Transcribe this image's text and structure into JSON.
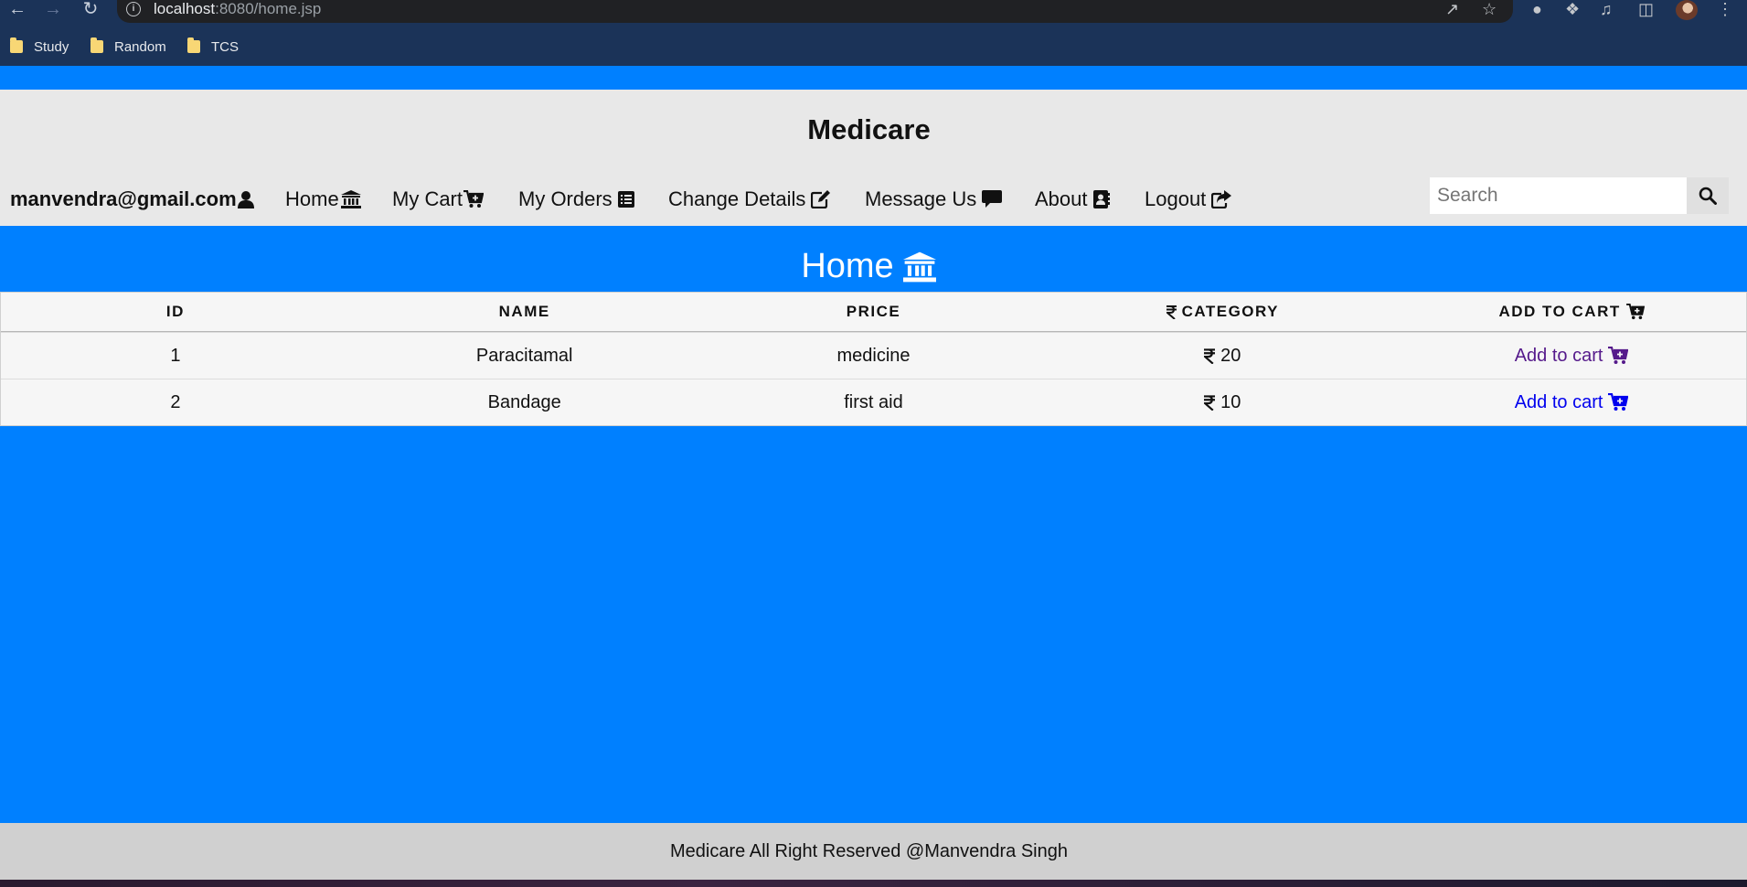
{
  "browser": {
    "url_host": "localhost",
    "url_path": ":8080/home.jsp",
    "bookmarks": [
      "Study",
      "Random",
      "TCS"
    ]
  },
  "header": {
    "brand": "Medicare",
    "user_email": "manvendra@gmail.com",
    "nav": [
      "Home",
      "My Cart",
      "My Orders",
      "Change Details",
      "Message Us",
      "About",
      "Logout"
    ],
    "search_placeholder": "Search"
  },
  "main": {
    "title": "Home",
    "columns": [
      "ID",
      "NAME",
      "PRICE",
      "CATEGORY",
      "ADD TO CART"
    ],
    "rows": [
      {
        "id": "1",
        "name": "Paracitamal",
        "category": "medicine",
        "price": "20",
        "action": "Add to cart"
      },
      {
        "id": "2",
        "name": "Bandage",
        "category": "first aid",
        "price": "10",
        "action": "Add to cart"
      }
    ]
  },
  "footer": {
    "text": "Medicare All Right Reserved @Manvendra Singh"
  },
  "colors": {
    "page_blue": "#0080ff",
    "header_gray": "#e8e8e8",
    "footer_gray": "#d0d0d0",
    "link_blue": "#0000ee",
    "link_visited": "#551a8b"
  },
  "icons": {
    "user": "user-icon",
    "home": "bank-icon",
    "cart": "cart-plus-icon",
    "orders": "list-alt-icon",
    "edit": "edit-icon",
    "message": "comment-icon",
    "about": "address-book-icon",
    "logout": "share-square-icon",
    "search": "search-icon",
    "rupee": "rupee-icon"
  }
}
